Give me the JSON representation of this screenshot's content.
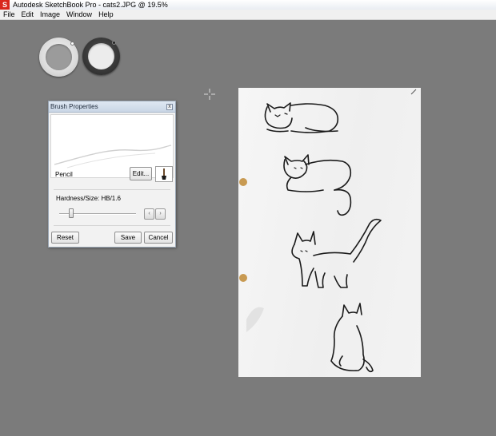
{
  "window": {
    "app_icon_letter": "S",
    "title": "Autodesk SketchBook Pro - cats2.JPG @ 19.5%"
  },
  "menu": {
    "items": [
      "File",
      "Edit",
      "Image",
      "Window",
      "Help"
    ]
  },
  "brush_panel": {
    "title": "Brush Properties",
    "close_glyph": "x",
    "brush_name": "Pencil",
    "edit_label": "Edit...",
    "hardness_label": "Hardness/Size: HB/1.6",
    "stepper_left_glyph": "‹",
    "stepper_right_glyph": "›",
    "reset_label": "Reset",
    "save_label": "Save",
    "cancel_label": "Cancel"
  },
  "colors": {
    "workspace": "#7b7b7b",
    "primary_puck_color": "#9b9b9b",
    "secondary_puck_color": "#ececec",
    "ink": "#1a1a1a",
    "paper": "#f2f2f2",
    "brand": "#d9261c"
  },
  "icons": {
    "app": "sketchbook-s-icon",
    "cursor": "crosshair-icon",
    "close": "close-icon",
    "brush": "pencil-brush-icon"
  }
}
